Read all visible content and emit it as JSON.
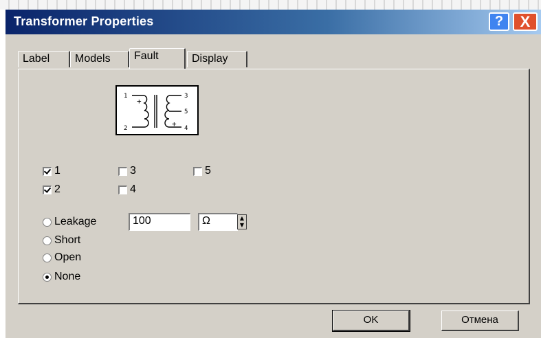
{
  "window": {
    "title": "Transformer Properties",
    "help_label": "?",
    "close_label": "X"
  },
  "tabs": [
    {
      "label": "Label",
      "active": false
    },
    {
      "label": "Models",
      "active": false
    },
    {
      "label": "Fault",
      "active": true
    },
    {
      "label": "Display",
      "active": false
    }
  ],
  "transformer": {
    "pins": [
      "1",
      "2",
      "3",
      "4",
      "5"
    ],
    "plus_marks": [
      "+",
      "+"
    ]
  },
  "fault_pins": [
    {
      "label": "1",
      "checked": true
    },
    {
      "label": "2",
      "checked": true
    },
    {
      "label": "3",
      "checked": false
    },
    {
      "label": "4",
      "checked": false
    },
    {
      "label": "5",
      "checked": false
    }
  ],
  "fault_types": [
    {
      "label": "Leakage",
      "selected": false
    },
    {
      "label": "Short",
      "selected": false
    },
    {
      "label": "Open",
      "selected": false
    },
    {
      "label": "None",
      "selected": true
    }
  ],
  "leakage": {
    "value": "100",
    "unit": "Ω"
  },
  "buttons": {
    "ok": "OK",
    "cancel": "Отмена"
  },
  "colors": {
    "titlebar_start": "#0a246a",
    "titlebar_end": "#a6caf0",
    "face": "#d4d0c8",
    "close": "#e0502c",
    "help": "#3f84f0"
  }
}
